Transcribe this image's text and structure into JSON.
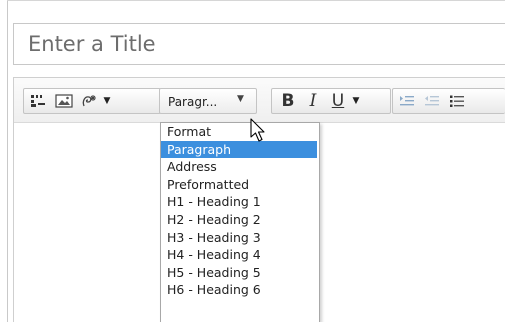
{
  "title_field": {
    "placeholder": "Enter a Title"
  },
  "toolbar": {
    "icons": [
      "insert-block-icon",
      "image-icon",
      "special-chars-icon"
    ],
    "format_select_value": "Paragr...",
    "bold_label": "B",
    "italic_label": "I",
    "underline_label": "U"
  },
  "format_dropdown": {
    "items": [
      {
        "label": "Format",
        "selected": false
      },
      {
        "label": "Paragraph",
        "selected": true
      },
      {
        "label": "Address",
        "selected": false
      },
      {
        "label": "Preformatted",
        "selected": false
      },
      {
        "label": "H1 - Heading 1",
        "selected": false
      },
      {
        "label": "H2 - Heading 2",
        "selected": false
      },
      {
        "label": "H3 - Heading 3",
        "selected": false
      },
      {
        "label": "H4 - Heading 4",
        "selected": false
      },
      {
        "label": "H5 - Heading 5",
        "selected": false
      },
      {
        "label": "H6 - Heading 6",
        "selected": false
      }
    ]
  },
  "colors": {
    "selected_highlight": "#3c8fde",
    "placeholder_text": "#6d6d6d"
  }
}
